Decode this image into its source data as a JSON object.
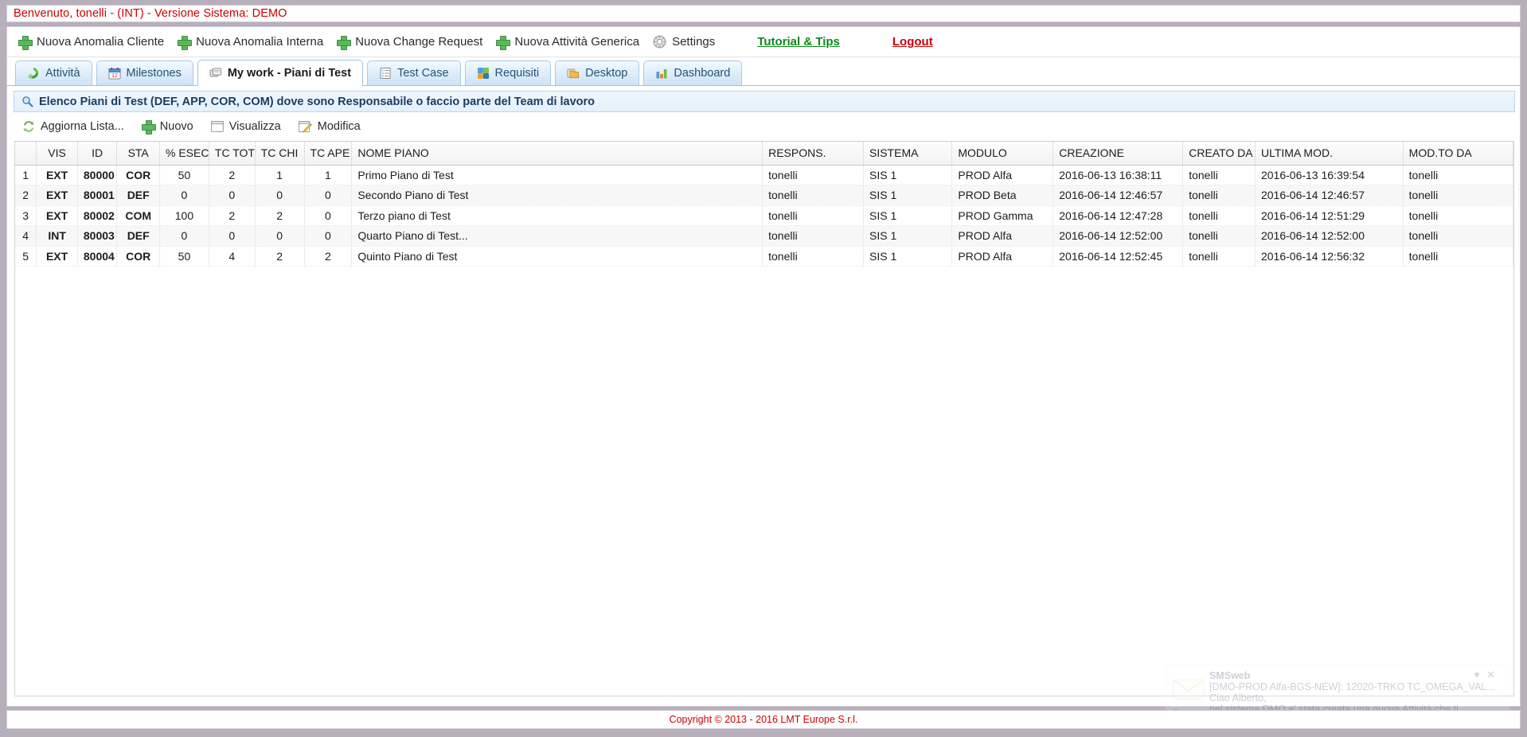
{
  "welcome": {
    "text": "Benvenuto, tonelli - (INT) - Versione Sistema: DEMO"
  },
  "menubar": {
    "items": [
      {
        "label": "Nuova Anomalia Cliente",
        "icon": "plus-icon"
      },
      {
        "label": "Nuova Anomalia Interna",
        "icon": "plus-icon"
      },
      {
        "label": "Nuova Change Request",
        "icon": "plus-icon"
      },
      {
        "label": "Nuova Attività Generica",
        "icon": "plus-icon"
      },
      {
        "label": "Settings",
        "icon": "gear-icon"
      }
    ],
    "tutorial_link": "Tutorial & Tips",
    "logout_link": "Logout"
  },
  "tabs": [
    {
      "label": "Attività",
      "icon": "activity-icon",
      "active": false
    },
    {
      "label": "Milestones",
      "icon": "calendar-icon",
      "active": false
    },
    {
      "label": "My work - Piani di Test",
      "icon": "plans-icon",
      "active": true
    },
    {
      "label": "Test Case",
      "icon": "list-icon",
      "active": false
    },
    {
      "label": "Requisiti",
      "icon": "puzzle-icon",
      "active": false
    },
    {
      "label": "Desktop",
      "icon": "folder-icon",
      "active": false
    },
    {
      "label": "Dashboard",
      "icon": "chart-icon",
      "active": false
    }
  ],
  "section": {
    "icon": "search-icon",
    "title": "Elenco Piani di Test (DEF, APP, COR, COM) dove sono Responsabile o faccio parte del Team di lavoro"
  },
  "actions": [
    {
      "label": "Aggiorna Lista...",
      "icon": "refresh-icon"
    },
    {
      "label": "Nuovo",
      "icon": "plus-icon"
    },
    {
      "label": "Visualizza",
      "icon": "window-icon"
    },
    {
      "label": "Modifica",
      "icon": "edit-icon"
    }
  ],
  "grid": {
    "columns": [
      {
        "key": "num",
        "label": "",
        "align": "c"
      },
      {
        "key": "vis",
        "label": "VIS",
        "align": "c"
      },
      {
        "key": "id",
        "label": "ID",
        "align": "c"
      },
      {
        "key": "sta",
        "label": "STA",
        "align": "c"
      },
      {
        "key": "esec",
        "label": "% ESEC",
        "align": "c"
      },
      {
        "key": "tctot",
        "label": "TC TOT",
        "align": "c"
      },
      {
        "key": "tcchi",
        "label": "TC CHI",
        "align": "c"
      },
      {
        "key": "tcape",
        "label": "TC APE",
        "align": "c"
      },
      {
        "key": "nome",
        "label": "NOME PIANO",
        "align": "l"
      },
      {
        "key": "respons",
        "label": "RESPONS.",
        "align": "l"
      },
      {
        "key": "sistema",
        "label": "SISTEMA",
        "align": "l"
      },
      {
        "key": "modulo",
        "label": "MODULO",
        "align": "l"
      },
      {
        "key": "creazione",
        "label": "CREAZIONE",
        "align": "l"
      },
      {
        "key": "creatoda",
        "label": "CREATO DA",
        "align": "l"
      },
      {
        "key": "ultmod",
        "label": "ULTIMA MOD.",
        "align": "l"
      },
      {
        "key": "modtoda",
        "label": "MOD.TO DA",
        "align": "l"
      }
    ],
    "rows": [
      {
        "num": "1",
        "vis": "EXT",
        "vis_color": "red",
        "id": "80000",
        "sta": "COR",
        "sta_color": "orange",
        "esec": "50",
        "tctot": "2",
        "tcchi": "1",
        "tcape": "1",
        "nome": "Primo Piano di Test",
        "respons": "tonelli",
        "sistema": "SIS 1",
        "modulo": "PROD Alfa",
        "creazione": "2016-06-13 16:38:11",
        "creatoda": "tonelli",
        "ultmod": "2016-06-13 16:39:54",
        "modtoda": "tonelli"
      },
      {
        "num": "2",
        "vis": "EXT",
        "vis_color": "red",
        "id": "80001",
        "sta": "DEF",
        "sta_color": "red",
        "esec": "0",
        "tctot": "0",
        "tcchi": "0",
        "tcape": "0",
        "nome": "Secondo Piano di Test",
        "respons": "tonelli",
        "sistema": "SIS 1",
        "modulo": "PROD Beta",
        "creazione": "2016-06-14 12:46:57",
        "creatoda": "tonelli",
        "ultmod": "2016-06-14 12:46:57",
        "modtoda": "tonelli"
      },
      {
        "num": "3",
        "vis": "EXT",
        "vis_color": "red",
        "id": "80002",
        "sta": "COM",
        "sta_color": "green",
        "esec": "100",
        "tctot": "2",
        "tcchi": "2",
        "tcape": "0",
        "nome": "Terzo piano di Test",
        "respons": "tonelli",
        "sistema": "SIS 1",
        "modulo": "PROD Gamma",
        "creazione": "2016-06-14 12:47:28",
        "creatoda": "tonelli",
        "ultmod": "2016-06-14 12:51:29",
        "modtoda": "tonelli"
      },
      {
        "num": "4",
        "vis": "INT",
        "vis_color": "green",
        "id": "80003",
        "sta": "DEF",
        "sta_color": "red",
        "esec": "0",
        "tctot": "0",
        "tcchi": "0",
        "tcape": "0",
        "nome": "Quarto Piano di Test...",
        "respons": "tonelli",
        "sistema": "SIS 1",
        "modulo": "PROD Alfa",
        "creazione": "2016-06-14 12:52:00",
        "creatoda": "tonelli",
        "ultmod": "2016-06-14 12:52:00",
        "modtoda": "tonelli"
      },
      {
        "num": "5",
        "vis": "EXT",
        "vis_color": "red",
        "id": "80004",
        "sta": "COR",
        "sta_color": "orange",
        "esec": "50",
        "tctot": "4",
        "tcchi": "2",
        "tcape": "2",
        "nome": "Quinto Piano di Test",
        "respons": "tonelli",
        "sistema": "SIS 1",
        "modulo": "PROD Alfa",
        "creazione": "2016-06-14 12:52:45",
        "creatoda": "tonelli",
        "ultmod": "2016-06-14 12:56:32",
        "modtoda": "tonelli"
      }
    ]
  },
  "toast": {
    "title": "SMSweb",
    "subject": "[DMO-PROD Alfa-BGS-NEW]: 12020-TRKO TC_OMEGA_VAL...",
    "line1": "Ciao Alberto,",
    "line2": "nel sistema DMO e' stata creata una nuova Attività che ti",
    "minimize_label": "▾",
    "close_label": "✕"
  },
  "footer": {
    "text": "Copyright © 2013 - 2016 LMT Europe S.r.l."
  },
  "colors": {
    "red": "#d00000",
    "green": "#1a8a1a",
    "orange": "#f0900a",
    "accent_blue": "#1a3d63"
  }
}
